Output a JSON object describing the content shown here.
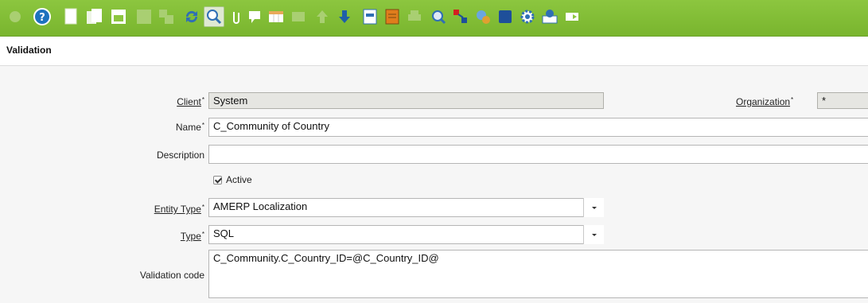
{
  "toolbar": {
    "buttons": [
      {
        "name": "ignore-icon",
        "color": "#b5d68a"
      },
      {
        "name": "help-icon",
        "color": "#1e73be"
      },
      {
        "name": "new-record-icon",
        "color": "#ffffff"
      },
      {
        "name": "copy-record-icon",
        "color": "#ffffff"
      },
      {
        "name": "delete-record-icon",
        "color": "#ffffff"
      },
      {
        "name": "save-icon",
        "color": "#b5d68a"
      },
      {
        "name": "save-disabled-icon",
        "color": "#b5d68a"
      },
      {
        "name": "refresh-icon",
        "color": "#2f6fb5"
      },
      {
        "name": "find-icon",
        "color": "#2f6fb5"
      },
      {
        "name": "attachment-icon",
        "color": "#ffffff"
      },
      {
        "name": "chat-icon",
        "color": "#ffffff"
      },
      {
        "name": "grid-toggle-icon",
        "color": "#ffffff"
      },
      {
        "name": "history-icon",
        "color": "#b5d68a"
      },
      {
        "name": "previous-record-icon",
        "color": "#b5d68a"
      },
      {
        "name": "next-record-icon",
        "color": "#1e5fa8"
      },
      {
        "name": "report-icon",
        "color": "#2f6fb5"
      },
      {
        "name": "archive-icon",
        "color": "#e07d1c"
      },
      {
        "name": "print-icon",
        "color": "#b5d68a"
      },
      {
        "name": "zoom-across-icon",
        "color": "#2f6fb5"
      },
      {
        "name": "workflow-icon",
        "color": "#d42020"
      },
      {
        "name": "process-icon",
        "color": "#2f6fb5"
      },
      {
        "name": "product-info-icon",
        "color": "#1e4f9a"
      },
      {
        "name": "settings-icon",
        "color": "#2f6fb5"
      },
      {
        "name": "export-icon",
        "color": "#2f6fb5"
      },
      {
        "name": "exit-icon",
        "color": "#ffffff"
      }
    ]
  },
  "page": {
    "title": "Validation"
  },
  "form": {
    "client": {
      "label": "Client",
      "required": "*",
      "value": "System"
    },
    "organization": {
      "label": "Organization",
      "required": "*",
      "value": "*"
    },
    "name": {
      "label": "Name",
      "required": "*",
      "value": "C_Community of Country"
    },
    "description": {
      "label": "Description",
      "value": ""
    },
    "active": {
      "label": "Active",
      "checked": true
    },
    "entity_type": {
      "label": "Entity Type",
      "required": "*",
      "value": "AMERP Localization"
    },
    "type": {
      "label": "Type",
      "required": "*",
      "value": "SQL"
    },
    "validation_code": {
      "label": "Validation code",
      "value": "C_Community.C_Country_ID=@C_Country_ID@"
    }
  }
}
